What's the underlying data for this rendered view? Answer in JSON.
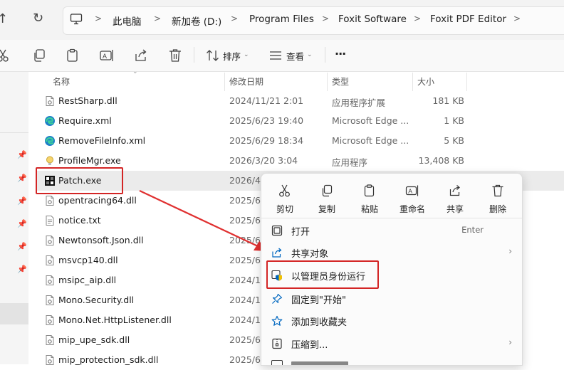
{
  "breadcrumb": [
    "此电脑",
    "新加卷 (D:)",
    "Program Files",
    "Foxit Software",
    "Foxit PDF Editor"
  ],
  "toolbar": {
    "sort_label": "排序",
    "view_label": "查看",
    "more_label": "···"
  },
  "columns": {
    "name": "名称",
    "date": "修改日期",
    "type": "类型",
    "size": "大小"
  },
  "files": [
    {
      "name": "RestSharp.dll",
      "date": "2024/11/21 2:01",
      "type": "应用程序扩展",
      "size": "181 KB",
      "icon": "dll-file-icon"
    },
    {
      "name": "Require.xml",
      "date": "2025/6/23 19:40",
      "type": "Microsoft Edge ...",
      "size": "1 KB",
      "icon": "edge-xml-icon"
    },
    {
      "name": "RemoveFileInfo.xml",
      "date": "2025/6/29 18:34",
      "type": "Microsoft Edge ...",
      "size": "5 KB",
      "icon": "edge-xml-icon"
    },
    {
      "name": "ProfileMgr.exe",
      "date": "2026/3/20 3:04",
      "type": "应用程序",
      "size": "13,408 KB",
      "icon": "lightbulb-exe-icon"
    },
    {
      "name": "Patch.exe",
      "date": "2026/4/",
      "type": "",
      "size": "",
      "icon": "patch-exe-icon"
    },
    {
      "name": "opentracing64.dll",
      "date": "2025/6",
      "type": "",
      "size": "",
      "icon": "dll-file-icon"
    },
    {
      "name": "notice.txt",
      "date": "2025/6",
      "type": "",
      "size": "",
      "icon": "txt-file-icon"
    },
    {
      "name": "Newtonsoft.Json.dll",
      "date": "2025/6",
      "type": "",
      "size": "",
      "icon": "dll-file-icon"
    },
    {
      "name": "msvcp140.dll",
      "date": "2025/6",
      "type": "",
      "size": "",
      "icon": "dll-file-icon"
    },
    {
      "name": "msipc_aip.dll",
      "date": "2024/1",
      "type": "",
      "size": "",
      "icon": "dll-file-icon"
    },
    {
      "name": "Mono.Security.dll",
      "date": "2024/1",
      "type": "",
      "size": "",
      "icon": "dll-file-icon"
    },
    {
      "name": "Mono.Net.HttpListener.dll",
      "date": "2024/1",
      "type": "",
      "size": "",
      "icon": "dll-file-icon"
    },
    {
      "name": "mip_upe_sdk.dll",
      "date": "2025/6",
      "type": "",
      "size": "",
      "icon": "dll-file-icon"
    },
    {
      "name": "mip_protection_sdk.dll",
      "date": "2025/6",
      "type": "",
      "size": "",
      "icon": "dll-file-icon"
    }
  ],
  "context_menu": {
    "quick_actions": [
      "剪切",
      "复制",
      "粘贴",
      "重命名",
      "共享",
      "删除"
    ],
    "items": [
      {
        "label": "打开",
        "shortcut": "Enter",
        "arrow": ""
      },
      {
        "label": "共享对象",
        "shortcut": "",
        "arrow": "›"
      },
      {
        "label": "以管理员身份运行",
        "shortcut": "",
        "arrow": ""
      },
      {
        "label": "固定到\"开始\"",
        "shortcut": "",
        "arrow": ""
      },
      {
        "label": "添加到收藏夹",
        "shortcut": "",
        "arrow": ""
      },
      {
        "label": "压缩到...",
        "shortcut": "",
        "arrow": "›"
      }
    ]
  },
  "colors": {
    "highlight_red": "#d32525",
    "accent_blue": "#0067c0",
    "selected_row": "#ebebeb"
  }
}
